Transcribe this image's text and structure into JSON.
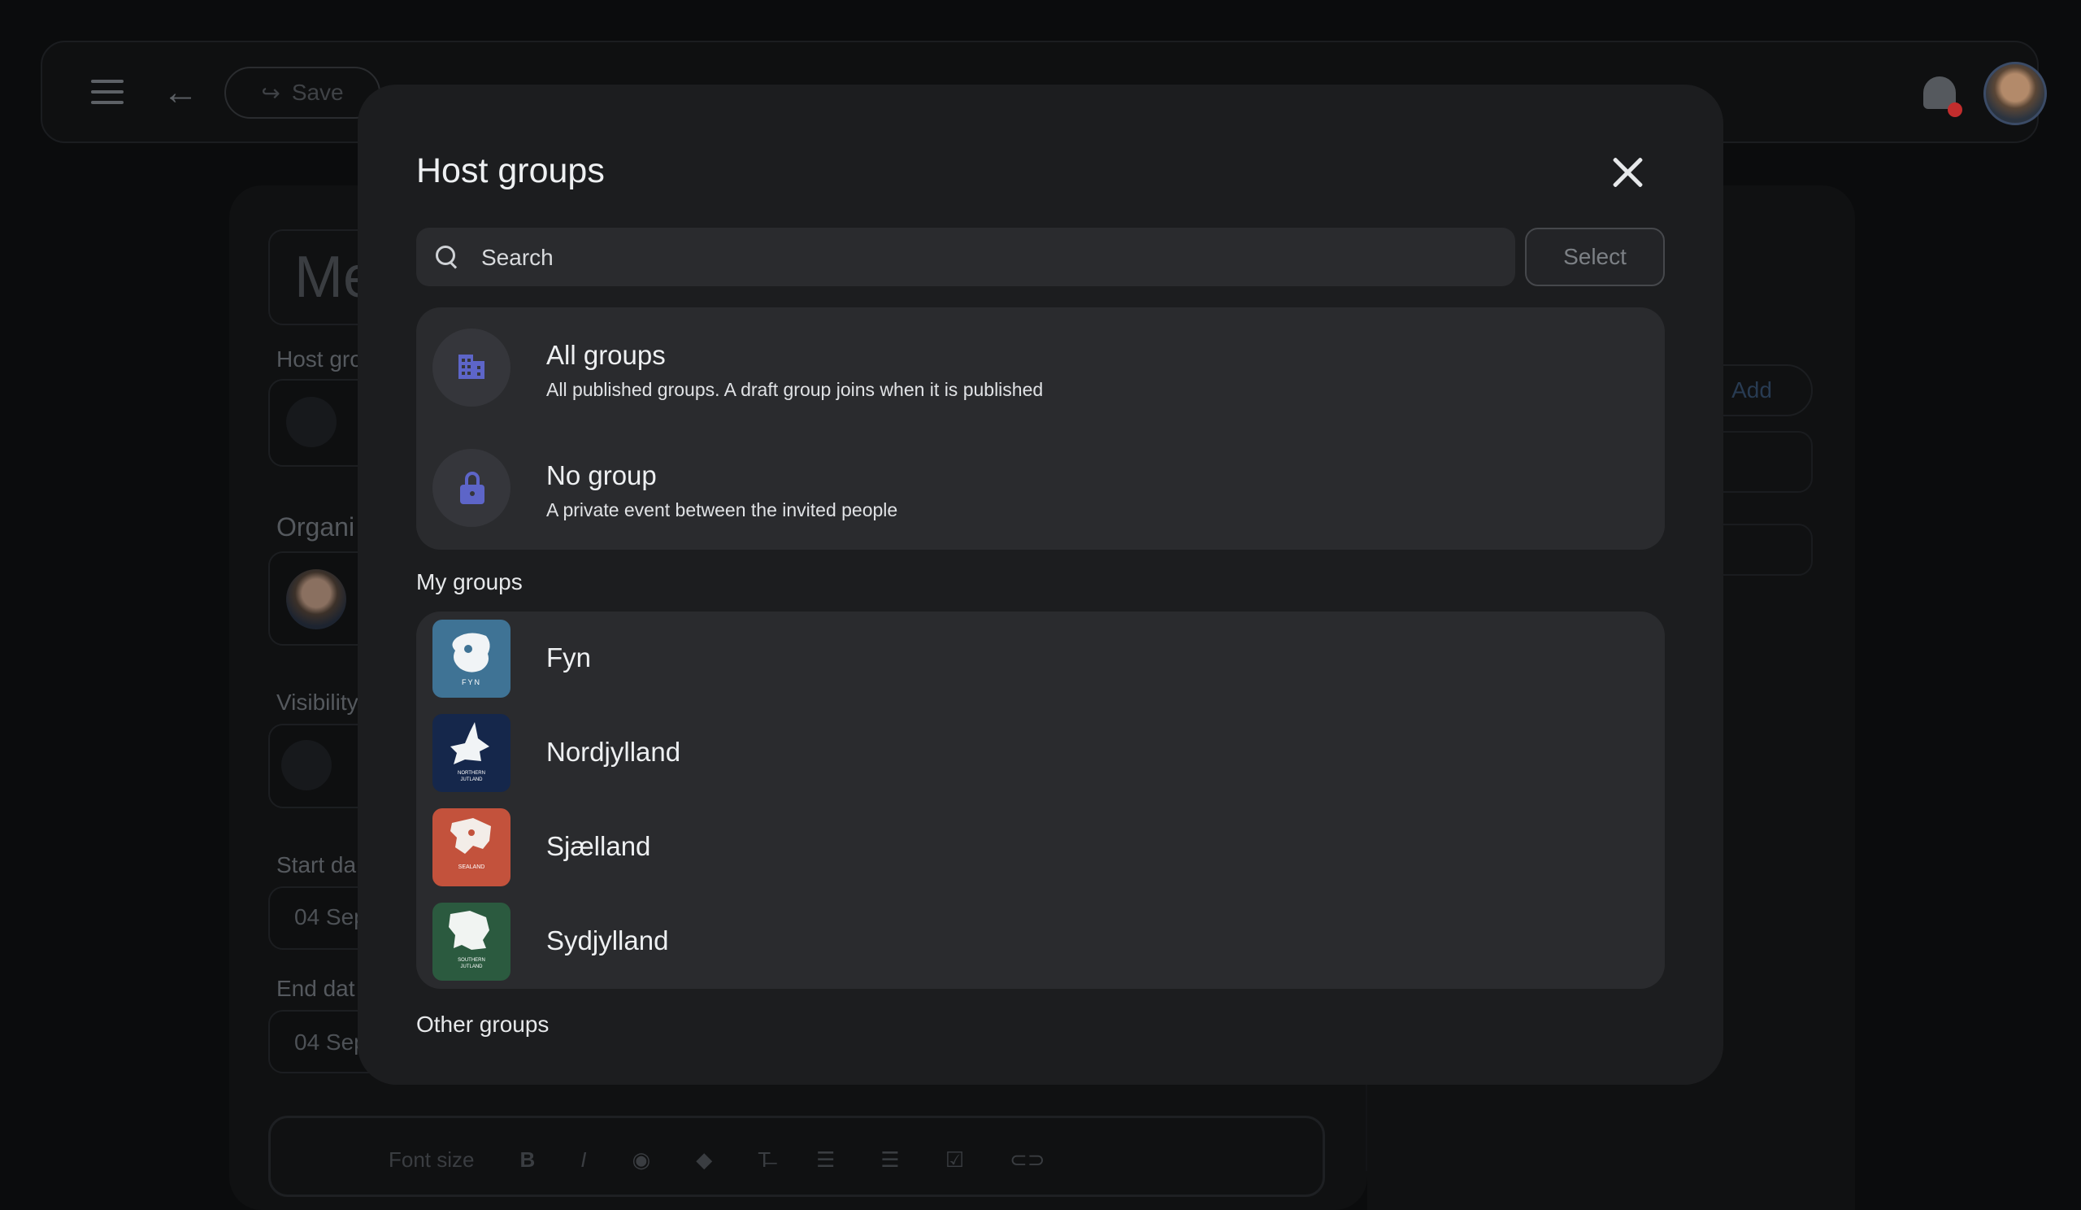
{
  "background": {
    "header": {
      "save_label": "Save"
    },
    "form": {
      "title_fragment": "Me",
      "host_groups_label": "Host gro",
      "organizer_label": "Organi",
      "visibility_label": "Visibility",
      "start_label": "Start da",
      "start_value": "04 Sep",
      "end_label": "End dat",
      "end_value": "04 Sep",
      "add_label": "Add",
      "font_size_label": "Font size"
    }
  },
  "modal": {
    "title": "Host groups",
    "search": {
      "placeholder": "Search"
    },
    "select_label": "Select",
    "options": [
      {
        "icon": "building-icon",
        "title": "All groups",
        "subtitle": "All published groups. A draft group joins when it is published"
      },
      {
        "icon": "lock-icon",
        "title": "No group",
        "subtitle": "A private event between the invited people"
      }
    ],
    "my_groups_label": "My groups",
    "my_groups": [
      {
        "name": "Fyn",
        "logo_text": "FYN",
        "color": "#3f7395"
      },
      {
        "name": "Nordjylland",
        "logo_text": "NORTHERN JUTLAND",
        "color": "#15274b"
      },
      {
        "name": "Sjælland",
        "logo_text": "SEALAND",
        "color": "#c3523c"
      },
      {
        "name": "Sydjylland",
        "logo_text": "SOUTHERN JUTLAND",
        "color": "#2b5a3f"
      }
    ],
    "other_groups_label": "Other groups"
  },
  "colors": {
    "accent_icon": "#5d65c8",
    "modal_bg": "#1c1d1f",
    "card_bg": "#2a2b2e",
    "notification_dot": "#c22d2d"
  }
}
